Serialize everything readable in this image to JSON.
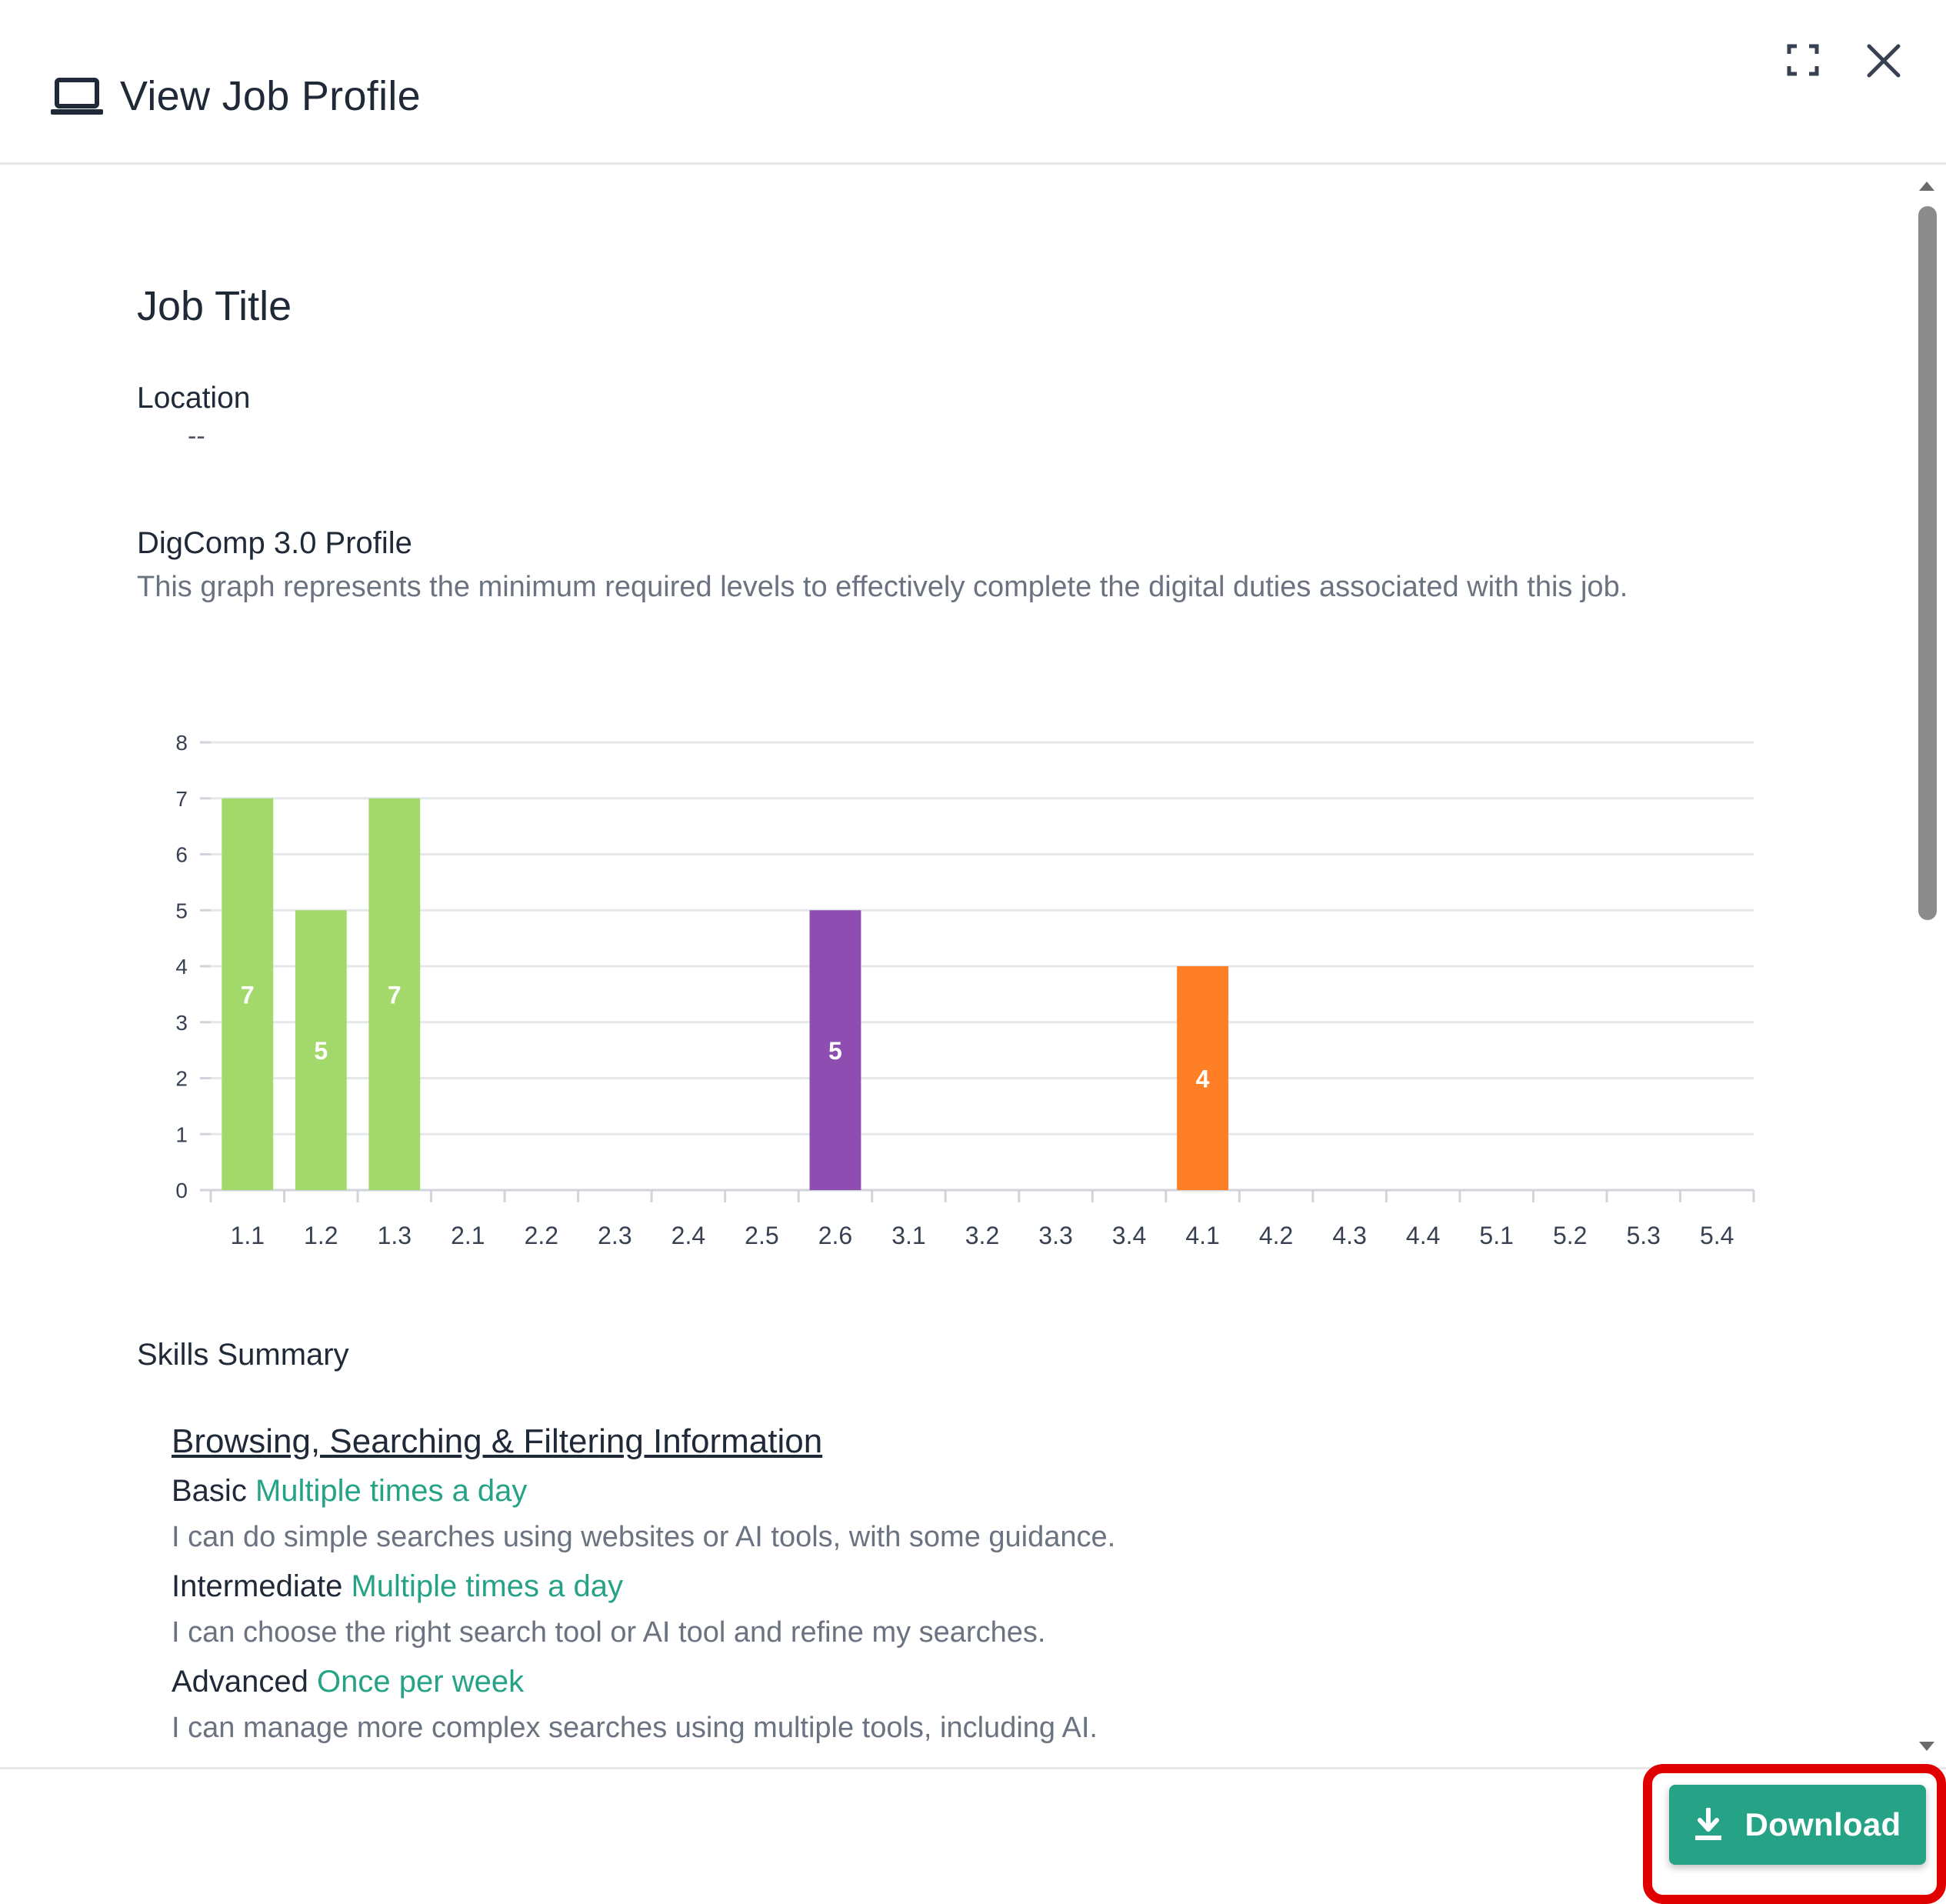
{
  "header": {
    "title": "View Job Profile",
    "icon": "laptop-icon",
    "expand_icon": "expand-icon",
    "close_icon": "close-icon"
  },
  "profile": {
    "job_title": "Job Title",
    "location_label": "Location",
    "location_value": "--",
    "digcomp_title": "DigComp 3.0 Profile",
    "digcomp_description": "This graph represents the minimum required levels to effectively complete the digital duties associated with this job."
  },
  "chart_data": {
    "type": "bar",
    "categories": [
      "1.1",
      "1.2",
      "1.3",
      "2.1",
      "2.2",
      "2.3",
      "2.4",
      "2.5",
      "2.6",
      "3.1",
      "3.2",
      "3.3",
      "3.4",
      "4.1",
      "4.2",
      "4.3",
      "4.4",
      "5.1",
      "5.2",
      "5.3",
      "5.4"
    ],
    "values": [
      7,
      5,
      7,
      0,
      0,
      0,
      0,
      0,
      5,
      0,
      0,
      0,
      0,
      4,
      0,
      0,
      0,
      0,
      0,
      0,
      0
    ],
    "colors": [
      "#a3d86b",
      "#a3d86b",
      "#a3d86b",
      "#a3d86b",
      "#a3d86b",
      "#8e4db0",
      "#8e4db0",
      "#8e4db0",
      "#8e4db0",
      "#8e4db0",
      "#8e4db0",
      "#8e4db0",
      "#8e4db0",
      "#ff7f27",
      "#ff7f27",
      "#ff7f27",
      "#ff7f27",
      "#ff7f27",
      "#ff7f27",
      "#ff7f27",
      "#ff7f27"
    ],
    "ylim": [
      0,
      8
    ],
    "yticks": [
      0,
      1,
      2,
      3,
      4,
      5,
      6,
      7,
      8
    ],
    "grid": true,
    "data_labels": true
  },
  "skills": {
    "title": "Skills Summary",
    "area_name": "Browsing, Searching & Filtering Information",
    "levels": [
      {
        "level": "Basic",
        "frequency": "Multiple times a day",
        "description": "I can do simple searches using websites or AI tools, with some guidance."
      },
      {
        "level": "Intermediate",
        "frequency": "Multiple times a day",
        "description": "I can choose the right search tool or AI tool and refine my searches."
      },
      {
        "level": "Advanced",
        "frequency": "Once per week",
        "description": "I can manage more complex searches using multiple tools, including AI."
      }
    ],
    "frequency_color": "#26a386"
  },
  "footer": {
    "download_label": "Download",
    "download_icon": "download-icon",
    "button_color": "#26a386",
    "highlight_color": "#e00000"
  }
}
